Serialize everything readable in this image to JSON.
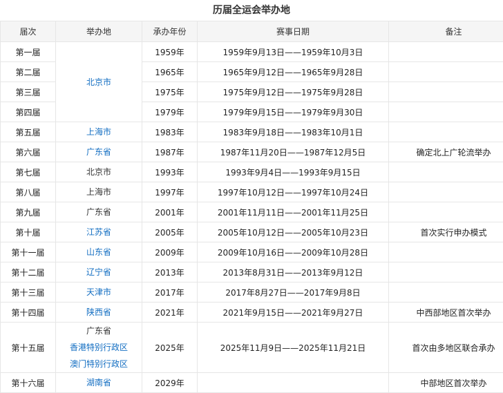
{
  "caption": "历届全运会举办地",
  "headers": [
    "届次",
    "举办地",
    "承办年份",
    "赛事日期",
    "备注"
  ],
  "colors": {
    "link": "#136ec2",
    "header_bg": "#f5f5f5",
    "border": "#e6e6e6"
  },
  "rows": [
    {
      "session": "第一届",
      "locations": [
        {
          "name": "北京市",
          "link": true
        }
      ],
      "loc_rowspan": 4,
      "year": "1959年",
      "dates": "1959年9月13日——1959年10月3日",
      "note": ""
    },
    {
      "session": "第二届",
      "year": "1965年",
      "dates": "1965年9月12日——1965年9月28日",
      "note": ""
    },
    {
      "session": "第三届",
      "year": "1975年",
      "dates": "1975年9月12日——1975年9月28日",
      "note": ""
    },
    {
      "session": "第四届",
      "year": "1979年",
      "dates": "1979年9月15日——1979年9月30日",
      "note": ""
    },
    {
      "session": "第五届",
      "locations": [
        {
          "name": "上海市",
          "link": true
        }
      ],
      "year": "1983年",
      "dates": "1983年9月18日——1983年10月1日",
      "note": ""
    },
    {
      "session": "第六届",
      "locations": [
        {
          "name": "广东省",
          "link": true
        }
      ],
      "year": "1987年",
      "dates": "1987年11月20日——1987年12月5日",
      "note": "确定北上广轮流举办"
    },
    {
      "session": "第七届",
      "locations": [
        {
          "name": "北京市",
          "link": false
        }
      ],
      "year": "1993年",
      "dates": "1993年9月4日——1993年9月15日",
      "note": ""
    },
    {
      "session": "第八届",
      "locations": [
        {
          "name": "上海市",
          "link": false
        }
      ],
      "year": "1997年",
      "dates": "1997年10月12日——1997年10月24日",
      "note": ""
    },
    {
      "session": "第九届",
      "locations": [
        {
          "name": "广东省",
          "link": false
        }
      ],
      "year": "2001年",
      "dates": "2001年11月11日——2001年11月25日",
      "note": ""
    },
    {
      "session": "第十届",
      "locations": [
        {
          "name": "江苏省",
          "link": true
        }
      ],
      "year": "2005年",
      "dates": "2005年10月12日——2005年10月23日",
      "note": "首次实行申办模式"
    },
    {
      "session": "第十一届",
      "locations": [
        {
          "name": "山东省",
          "link": true
        }
      ],
      "year": "2009年",
      "dates": "2009年10月16日——2009年10月28日",
      "note": ""
    },
    {
      "session": "第十二届",
      "locations": [
        {
          "name": "辽宁省",
          "link": true
        }
      ],
      "year": "2013年",
      "dates": "2013年8月31日——2013年9月12日",
      "note": ""
    },
    {
      "session": "第十三届",
      "locations": [
        {
          "name": "天津市",
          "link": true
        }
      ],
      "year": "2017年",
      "dates": "2017年8月27日——2017年9月8日",
      "note": ""
    },
    {
      "session": "第十四届",
      "locations": [
        {
          "name": "陕西省",
          "link": true
        }
      ],
      "year": "2021年",
      "dates": "2021年9月15日——2021年9月27日",
      "note": "中西部地区首次举办"
    },
    {
      "session": "第十五届",
      "locations": [
        {
          "name": "广东省",
          "link": false
        },
        {
          "name": "香港特别行政区",
          "link": true
        },
        {
          "name": "澳门特别行政区",
          "link": true
        }
      ],
      "year": "2025年",
      "dates": "2025年11月9日——2025年11月21日",
      "note": "首次由多地区联合承办"
    },
    {
      "session": "第十六届",
      "locations": [
        {
          "name": "湖南省",
          "link": true
        }
      ],
      "year": "2029年",
      "dates": "",
      "note": "中部地区首次举办"
    }
  ]
}
